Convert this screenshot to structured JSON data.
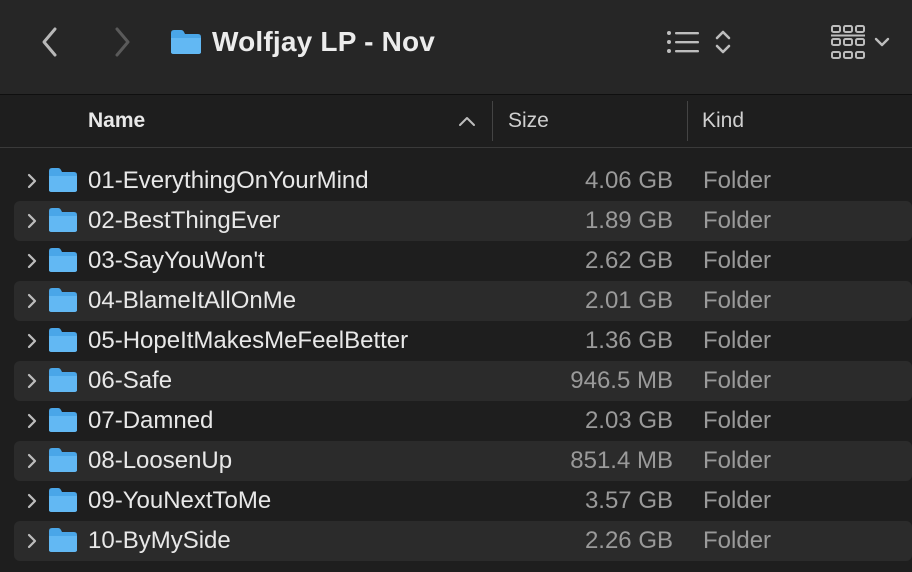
{
  "window": {
    "title": "Wolfjay LP - Nov"
  },
  "toolbar": {
    "back_icon": "chevron-left-icon",
    "forward_icon": "chevron-right-icon",
    "list_view_icon": "list-view-icon",
    "sort_icon": "up-down-chevron-icon",
    "group_icon": "icon-grid-icon",
    "group_menu_icon": "chevron-down-icon"
  },
  "columns": {
    "name": "Name",
    "size": "Size",
    "kind": "Kind"
  },
  "colors": {
    "folder_blue": "#5fb4f0",
    "row_alt": "#2b2b2b",
    "background": "#1e1e1e"
  },
  "rows": [
    {
      "name": "01-EverythingOnYourMind",
      "size": "4.06 GB",
      "kind": "Folder"
    },
    {
      "name": "02-BestThingEver",
      "size": "1.89 GB",
      "kind": "Folder"
    },
    {
      "name": "03-SayYouWon't",
      "size": "2.62 GB",
      "kind": "Folder"
    },
    {
      "name": "04-BlameItAllOnMe",
      "size": "2.01 GB",
      "kind": "Folder"
    },
    {
      "name": "05-HopeItMakesMeFeelBetter",
      "size": "1.36 GB",
      "kind": "Folder"
    },
    {
      "name": "06-Safe",
      "size": "946.5 MB",
      "kind": "Folder"
    },
    {
      "name": "07-Damned",
      "size": "2.03 GB",
      "kind": "Folder"
    },
    {
      "name": "08-LoosenUp",
      "size": "851.4 MB",
      "kind": "Folder"
    },
    {
      "name": "09-YouNextToMe",
      "size": "3.57 GB",
      "kind": "Folder"
    },
    {
      "name": "10-ByMySide",
      "size": "2.26 GB",
      "kind": "Folder"
    }
  ]
}
